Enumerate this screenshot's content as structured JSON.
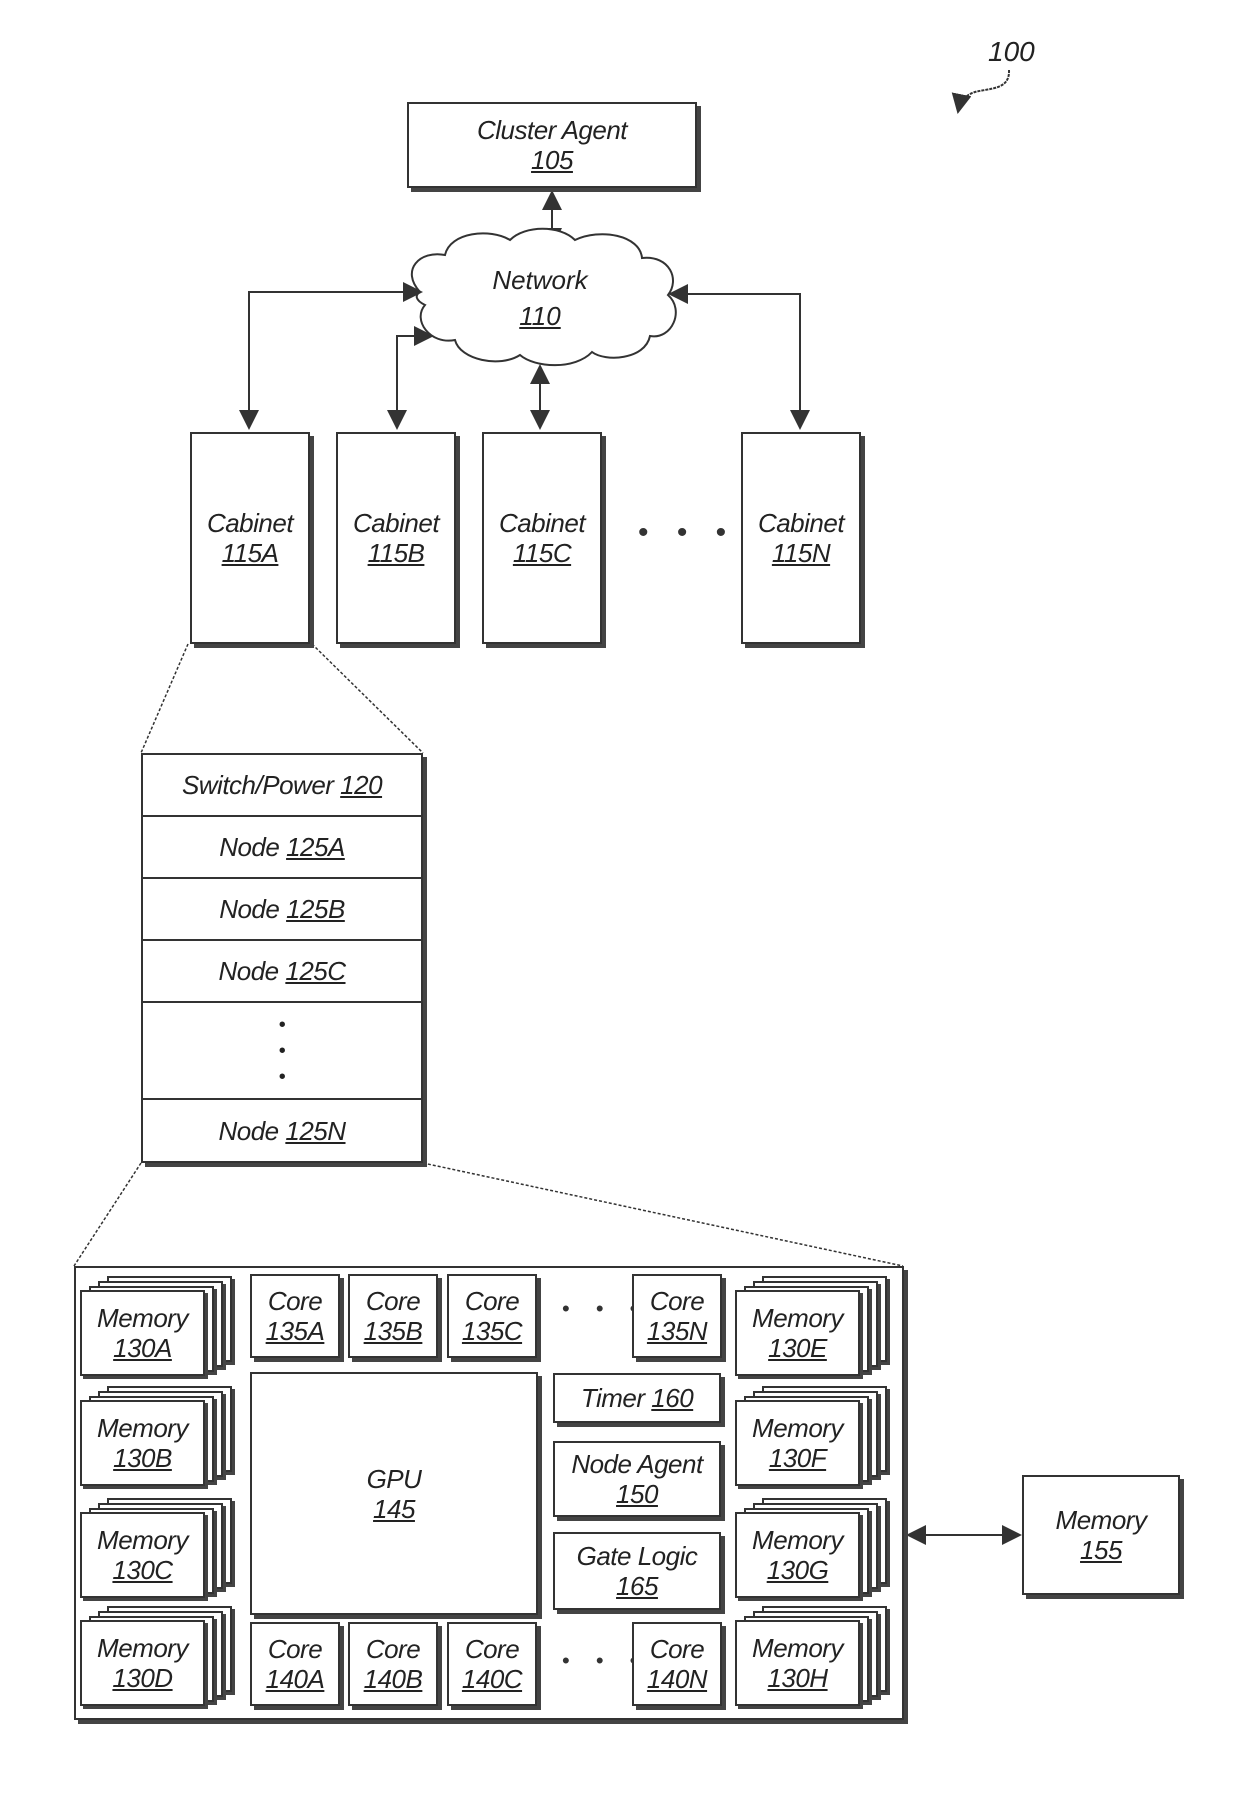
{
  "figure": {
    "ref": "100",
    "cluster_agent": {
      "name": "Cluster Agent",
      "ref": "105"
    },
    "network": {
      "name": "Network",
      "ref": "110"
    },
    "cabinets": [
      {
        "name": "Cabinet",
        "ref": "115A"
      },
      {
        "name": "Cabinet",
        "ref": "115B"
      },
      {
        "name": "Cabinet",
        "ref": "115C"
      },
      {
        "name": "Cabinet",
        "ref": "115N"
      }
    ],
    "cabinet_ellipsis": "• • •",
    "cabinet_detail": {
      "switch_power": {
        "name": "Switch/Power",
        "ref": "120"
      },
      "nodes": [
        {
          "name": "Node",
          "ref": "125A"
        },
        {
          "name": "Node",
          "ref": "125B"
        },
        {
          "name": "Node",
          "ref": "125C"
        },
        {
          "name": "Node",
          "ref": "125N"
        }
      ],
      "ellipsis": "•\n•\n•"
    },
    "node_detail": {
      "memories_left": [
        {
          "name": "Memory",
          "ref": "130A"
        },
        {
          "name": "Memory",
          "ref": "130B"
        },
        {
          "name": "Memory",
          "ref": "130C"
        },
        {
          "name": "Memory",
          "ref": "130D"
        }
      ],
      "memories_right": [
        {
          "name": "Memory",
          "ref": "130E"
        },
        {
          "name": "Memory",
          "ref": "130F"
        },
        {
          "name": "Memory",
          "ref": "130G"
        },
        {
          "name": "Memory",
          "ref": "130H"
        }
      ],
      "cores_top": [
        {
          "name": "Core",
          "ref": "135A"
        },
        {
          "name": "Core",
          "ref": "135B"
        },
        {
          "name": "Core",
          "ref": "135C"
        },
        {
          "name": "Core",
          "ref": "135N"
        }
      ],
      "cores_bottom": [
        {
          "name": "Core",
          "ref": "140A"
        },
        {
          "name": "Core",
          "ref": "140B"
        },
        {
          "name": "Core",
          "ref": "140C"
        },
        {
          "name": "Core",
          "ref": "140N"
        }
      ],
      "core_ellipsis": "• • •",
      "gpu": {
        "name": "GPU",
        "ref": "145"
      },
      "timer": {
        "name": "Timer",
        "ref": "160"
      },
      "node_agent": {
        "name": "Node Agent",
        "ref": "150"
      },
      "gate_logic": {
        "name": "Gate Logic",
        "ref": "165"
      }
    },
    "external_memory": {
      "name": "Memory",
      "ref": "155"
    }
  }
}
